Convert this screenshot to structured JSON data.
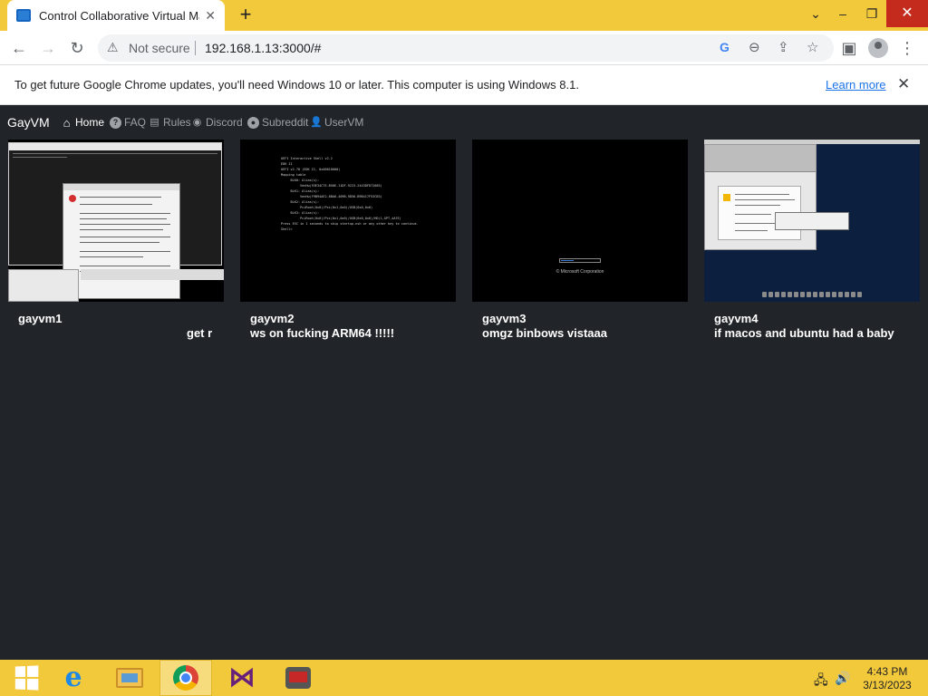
{
  "browser": {
    "tab_title": "Control Collaborative Virtual Ma",
    "security_label": "Not secure",
    "url": "192.168.1.13:3000/#",
    "infobar_message": "To get future Google Chrome updates, you'll need Windows 10 or later. This computer is using Windows 8.1.",
    "infobar_link": "Learn more"
  },
  "nav": {
    "brand": "GayVM",
    "items": [
      {
        "label": "Home",
        "icon": "home-icon",
        "active": true
      },
      {
        "label": "FAQ",
        "icon": "question-icon"
      },
      {
        "label": "Rules",
        "icon": "clipboard-icon"
      },
      {
        "label": "Discord",
        "icon": "discord-icon"
      },
      {
        "label": "Subreddit",
        "icon": "reddit-icon"
      },
      {
        "label": "UserVM",
        "icon": "user-icon"
      }
    ]
  },
  "vms": [
    {
      "name": "gayvm1",
      "title": "get r"
    },
    {
      "name": "gayvm2",
      "title": "ws on fucking ARM64 !!!!!"
    },
    {
      "name": "gayvm3",
      "title": "omgz binbows vistaaa"
    },
    {
      "name": "gayvm4",
      "title": "if macos and ubuntu had a baby"
    }
  ],
  "thumbs": {
    "vm2_console": "UEFI Interactive Shell v2.2\nEDK II\nUEFI v2.70 (EDK II, 0x00010000)\nMapping table\n     BLK0: Alias(s):\n          VenHw(93E34C7E-B50E-11DF-9223-2443DFD72085)\n     BLK1: Alias(s):\n          VenHw(F9B94AE2-8BA6-409B-9D56-B9B417F53CB3)\n     BLK2: Alias(s):\n          PciRoot(0x0)/Pci(0x1,0x0)/USB(0x0,0x0)\n     BLK3: Alias(s):\n          PciRoot(0x0)/Pci(0x1,0x0)/USB(0x0,0x0)/HD(1,GPT,4A7E)\nPress ESC in 1 seconds to skip startup.nsh or any other key to continue.\nShell>",
    "vm3_caption": "© Microsoft Corporation"
  },
  "taskbar": {
    "time": "4:43 PM",
    "date": "3/13/2023"
  },
  "colors": {
    "chrome_frame": "#f3c93c",
    "page_bg": "#212529",
    "link": "#1a73e8",
    "close_red": "#c42b1c"
  }
}
